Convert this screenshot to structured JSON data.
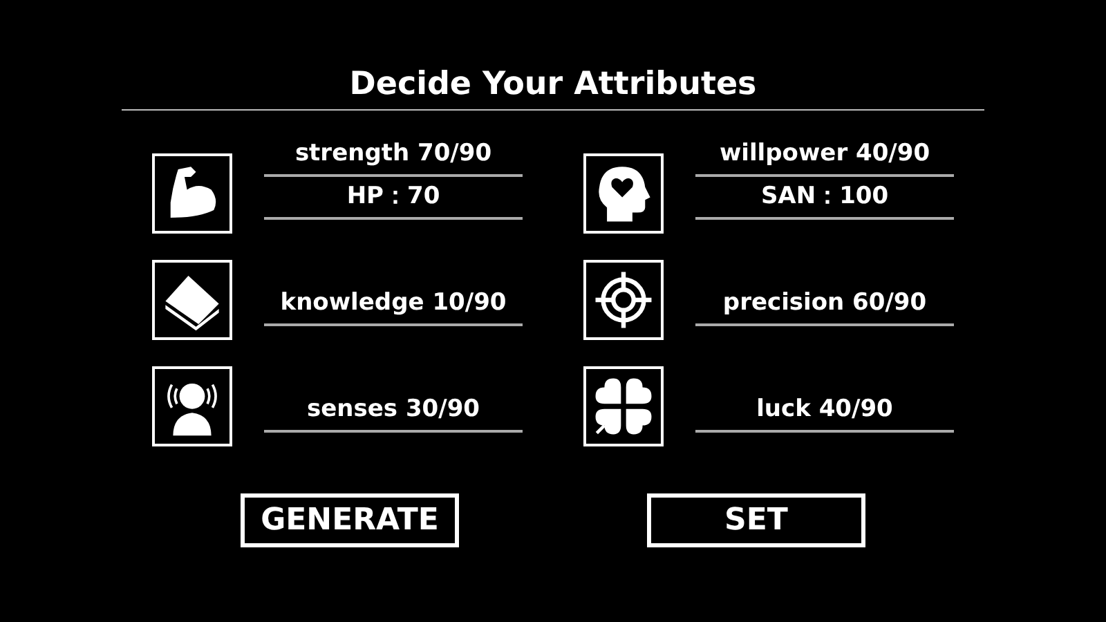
{
  "title": "Decide Your Attributes",
  "attributes": [
    {
      "lines": [
        "strength 70/90",
        "HP：70"
      ]
    },
    {
      "lines": [
        "willpower 40/90",
        "SAN：100"
      ]
    },
    {
      "lines": [
        "knowledge 10/90"
      ]
    },
    {
      "lines": [
        "precision 60/90"
      ]
    },
    {
      "lines": [
        "senses 30/90"
      ]
    },
    {
      "lines": [
        "luck 40/90"
      ]
    }
  ],
  "buttons": [
    "GENERATE",
    "SET"
  ]
}
